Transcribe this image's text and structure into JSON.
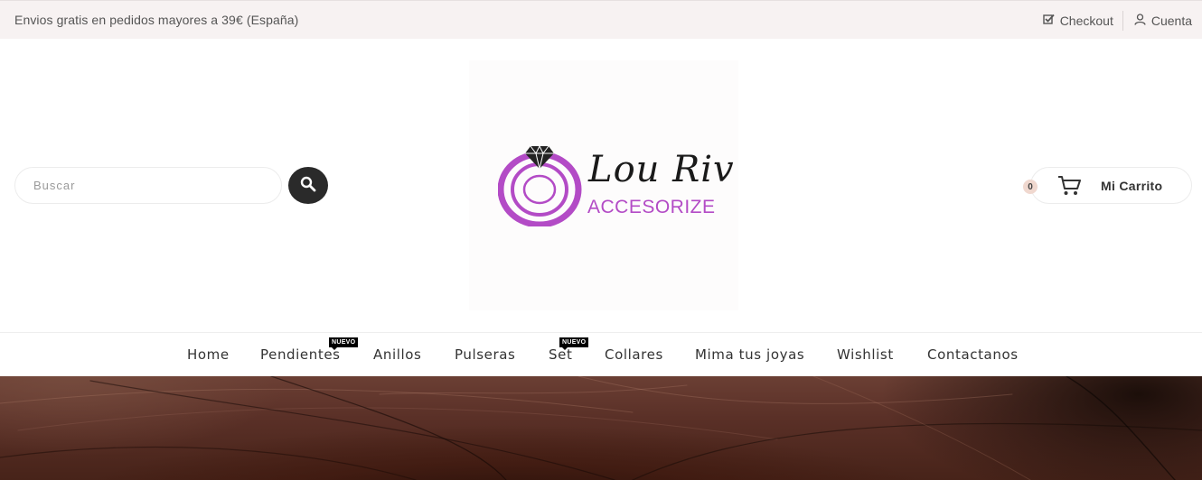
{
  "topbar": {
    "shipping_text": "Envios gratis en pedidos mayores a 39€ (España)",
    "checkout_label": "Checkout",
    "account_label": "Cuenta"
  },
  "search": {
    "placeholder": "Buscar"
  },
  "logo": {
    "line1": "Lou Riv",
    "line2": "ACCESORIZE"
  },
  "cart": {
    "count": "0",
    "label": "Mi Carrito"
  },
  "nav": {
    "items": [
      {
        "label": "Home"
      },
      {
        "label": "Pendientes",
        "badge": "NUEVO"
      },
      {
        "label": "Anillos"
      },
      {
        "label": "Pulseras"
      },
      {
        "label": "Set",
        "badge": "NUEVO"
      },
      {
        "label": "Collares"
      },
      {
        "label": "Mima tus joyas"
      },
      {
        "label": "Wishlist"
      },
      {
        "label": "Contactanos"
      }
    ]
  },
  "colors": {
    "brand_purple": "#b34bc6",
    "topbar_bg": "#f7f2f2",
    "search_button": "#2a2a2a"
  },
  "icons": {
    "checkout": "checkbox-icon",
    "account": "user-icon",
    "search": "search-icon",
    "cart": "cart-icon",
    "logo": "diamond-ring-icon"
  }
}
